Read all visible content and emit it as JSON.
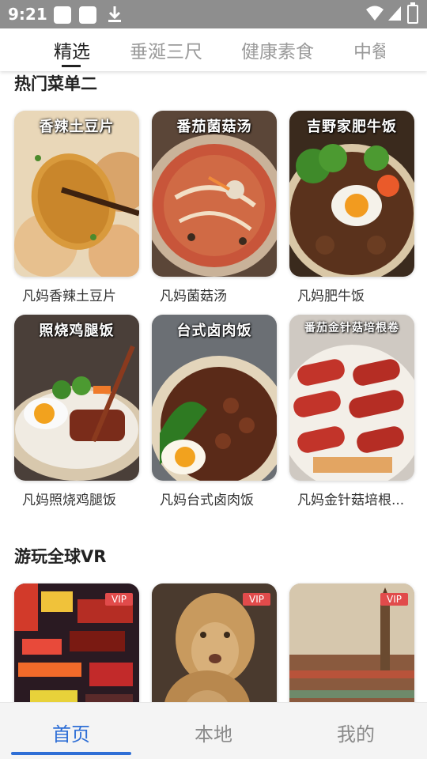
{
  "status_bar": {
    "time": "9:21"
  },
  "tabs": [
    {
      "label": "精选"
    },
    {
      "label": "垂涎三尺"
    },
    {
      "label": "健康素食"
    },
    {
      "label": "中餐"
    }
  ],
  "sections": {
    "menu": {
      "title": "热门菜单二",
      "items": [
        {
          "overlay": "香辣土豆片",
          "caption": "凡妈香辣土豆片"
        },
        {
          "overlay": "番茄菌菇汤",
          "caption": "凡妈菌菇汤"
        },
        {
          "overlay": "吉野家肥牛饭",
          "caption": "凡妈肥牛饭"
        },
        {
          "overlay": "照烧鸡腿饭",
          "caption": "凡妈照烧鸡腿饭"
        },
        {
          "overlay": "台式卤肉饭",
          "caption": "凡妈台式卤肉饭"
        },
        {
          "overlay": "番茄金针菇培根卷",
          "caption": "凡妈金针菇培根..."
        }
      ]
    },
    "vr": {
      "title": "游玩全球VR",
      "items": [
        {
          "badge": "VIP"
        },
        {
          "badge": "VIP"
        },
        {
          "badge": "VIP"
        }
      ]
    }
  },
  "bottom_nav": [
    {
      "label": "首页"
    },
    {
      "label": "本地"
    },
    {
      "label": "我的"
    }
  ]
}
